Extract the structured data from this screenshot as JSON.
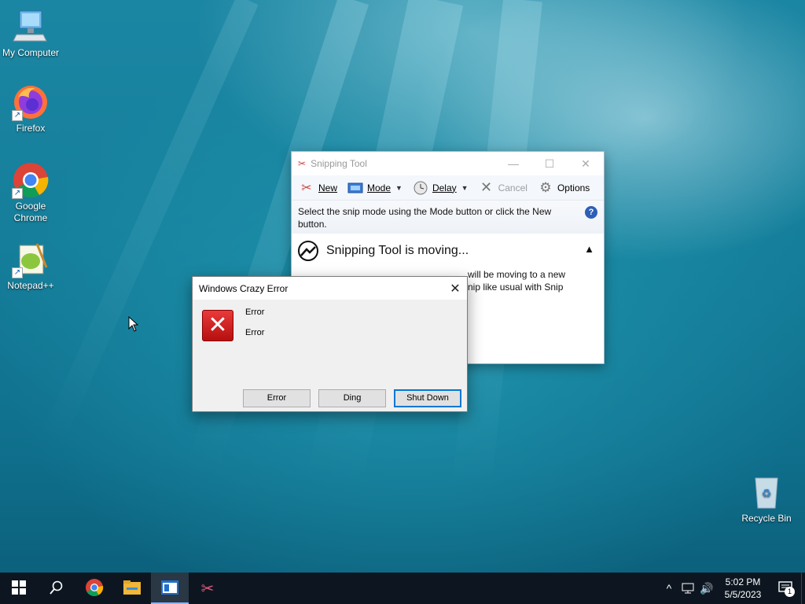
{
  "desktop": {
    "icons": [
      {
        "label": "My Computer",
        "icon": "computer-icon"
      },
      {
        "label": "Firefox",
        "icon": "firefox-icon"
      },
      {
        "label": "Google Chrome",
        "icon": "chrome-icon"
      },
      {
        "label": "Notepad++",
        "icon": "notepadpp-icon"
      },
      {
        "label": "Recycle Bin",
        "icon": "recycle-bin-icon"
      }
    ]
  },
  "snipping_tool": {
    "title": "Snipping Tool",
    "toolbar": {
      "new_label": "New",
      "mode_label": "Mode",
      "delay_label": "Delay",
      "cancel_label": "Cancel",
      "options_label": "Options"
    },
    "hint": "Select the snip mode using the Mode button or click the New button.",
    "moving_title": "Snipping Tool is moving...",
    "moving_body": "will be moving to a new\nnip like usual with Snip"
  },
  "error_dialog": {
    "title": "Windows Crazy Error",
    "line1": "Error",
    "line2": "Error",
    "buttons": {
      "error": "Error",
      "ding": "Ding",
      "shutdown": "Shut Down"
    }
  },
  "taskbar": {
    "apps": [
      "start-icon",
      "search-icon",
      "chrome-icon",
      "file-explorer-icon",
      "app-window-icon",
      "snipping-tool-icon"
    ],
    "time": "5:02 PM",
    "date": "5/5/2023",
    "notification_count": "1"
  }
}
